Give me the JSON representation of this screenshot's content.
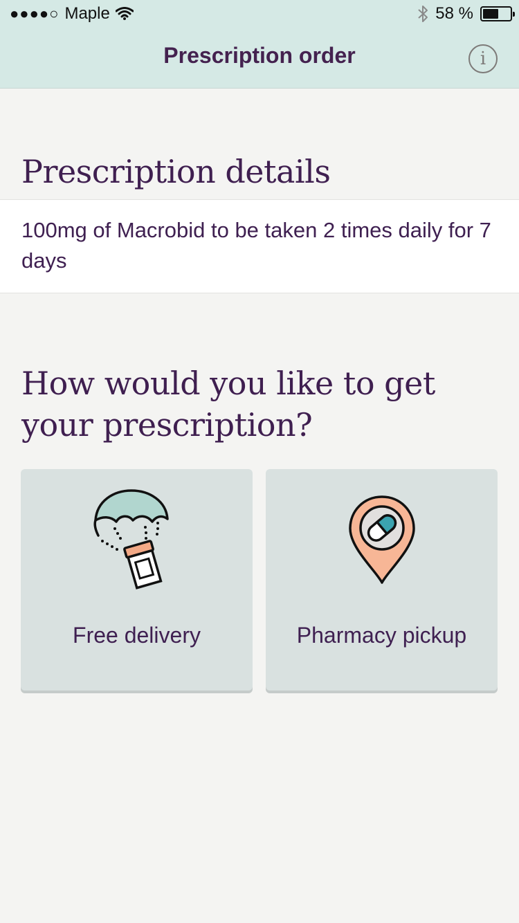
{
  "status_bar": {
    "signal_dots": "●●●●○",
    "carrier": "Maple",
    "battery_percent": "58 %",
    "battery_level": 0.58
  },
  "nav": {
    "title": "Prescription order",
    "info_label": "i"
  },
  "details": {
    "heading": "Prescription details",
    "text": "100mg of Macrobid to be taken 2 times daily for 7 days"
  },
  "question": {
    "heading": "How would you like to get your prescription?"
  },
  "options": [
    {
      "label": "Free delivery",
      "icon": "parachute-pill-bottle-icon"
    },
    {
      "label": "Pharmacy pickup",
      "icon": "map-pin-pill-icon"
    }
  ],
  "colors": {
    "header_bg": "#d5e9e5",
    "text_purple": "#3f2051",
    "card_bg": "#d9e1e0",
    "parachute_green": "#b1d6cf",
    "bottle_orange": "#f3a986",
    "pin_peach": "#f7b696",
    "capsule_teal": "#3ba3b0"
  }
}
